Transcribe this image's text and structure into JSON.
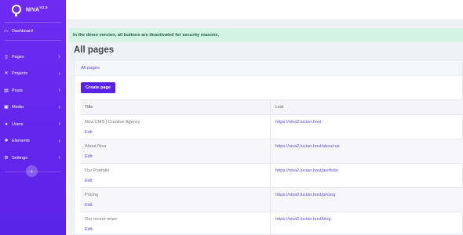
{
  "brand": {
    "name": "NIVA",
    "version": "V2.0"
  },
  "sidebar": {
    "dashboard": {
      "label": "Dashboard",
      "icon": "dashboard-icon"
    },
    "items": [
      {
        "label": "Pages",
        "icon": "pages-icon"
      },
      {
        "label": "Projects",
        "icon": "projects-icon"
      },
      {
        "label": "Posts",
        "icon": "posts-icon"
      },
      {
        "label": "Media",
        "icon": "media-icon"
      },
      {
        "label": "Users",
        "icon": "users-icon"
      },
      {
        "label": "Elements",
        "icon": "elements-icon"
      },
      {
        "label": "Settings",
        "icon": "settings-icon"
      }
    ],
    "collapse_icon": "‹"
  },
  "alert": {
    "text": "In the demo version, all buttons are deactivated for security reasons."
  },
  "page": {
    "title": "All pages"
  },
  "breadcrumb": {
    "current": "All pages"
  },
  "actions": {
    "create_label": "Create page"
  },
  "table": {
    "headers": {
      "title": "Title",
      "link": "Link"
    },
    "edit_label": "Edit",
    "rows": [
      {
        "title": "Niva CMS | Creative Agency",
        "link": "https://niva2.lucian.host"
      },
      {
        "title": "About Niva",
        "link": "https://niva2.lucian.host/about-us"
      },
      {
        "title": "Our Portfolio",
        "link": "https://niva2.lucian.host/portfolio"
      },
      {
        "title": "Pricing",
        "link": "https://niva2.lucian.host/pricing"
      },
      {
        "title": "Our recent news",
        "link": "https://niva2.lucian.host/blog"
      }
    ]
  },
  "colors": {
    "sidebar": "#6f2bf2",
    "accent": "#5a22e6",
    "alert_bg": "#d4f4e3",
    "link": "#5b4bdb"
  }
}
